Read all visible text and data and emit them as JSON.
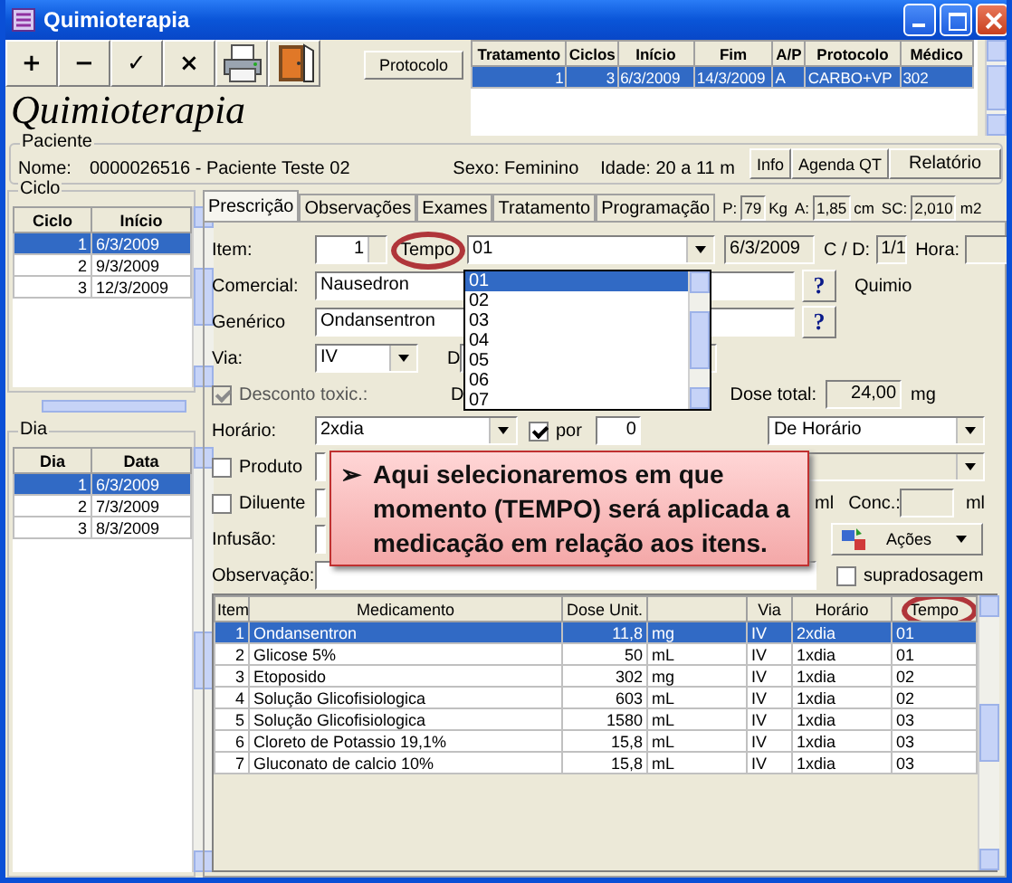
{
  "window": {
    "title": "Quimioterapia"
  },
  "toolbar": [
    {
      "kind": "glyph",
      "label": "+"
    },
    {
      "kind": "glyph",
      "label": "−"
    },
    {
      "kind": "glyph",
      "label": "✓"
    },
    {
      "kind": "glyph",
      "label": "×"
    },
    {
      "kind": "printer"
    },
    {
      "kind": "door"
    }
  ],
  "protocol_button": "Protocolo",
  "heading": "Quimioterapia",
  "treatments": {
    "columns": [
      "Tratamento",
      "Ciclos",
      "Início",
      "Fim",
      "A/P",
      "Protocolo",
      "Médico"
    ],
    "rows": [
      {
        "cells": [
          "1",
          "3",
          "6/3/2009",
          "14/3/2009",
          "A",
          "CARBO+VP",
          "302"
        ],
        "selected": true
      }
    ]
  },
  "patient": {
    "group": "Paciente",
    "name_label": "Nome:",
    "name": "0000026516 - Paciente Teste 02",
    "sex": "Sexo: Feminino",
    "age": "Idade: 20 a 11 m",
    "buttons": [
      "Info",
      "Agenda QT",
      "Relatório"
    ]
  },
  "cycles": {
    "group": "Ciclo",
    "columns": [
      "Ciclo",
      "Início"
    ],
    "rows": [
      {
        "cells": [
          "1",
          "6/3/2009"
        ],
        "selected": true
      },
      {
        "cells": [
          "2",
          "9/3/2009"
        ],
        "selected": false
      },
      {
        "cells": [
          "3",
          "12/3/2009"
        ],
        "selected": false
      }
    ]
  },
  "days": {
    "group": "Dia",
    "columns": [
      "Dia",
      "Data"
    ],
    "rows": [
      {
        "cells": [
          "1",
          "6/3/2009"
        ],
        "selected": true
      },
      {
        "cells": [
          "2",
          "7/3/2009"
        ],
        "selected": false
      },
      {
        "cells": [
          "3",
          "8/3/2009"
        ],
        "selected": false
      }
    ]
  },
  "tabs": [
    {
      "label": "Prescrição",
      "selected": true
    },
    {
      "label": "Observações",
      "selected": false
    },
    {
      "label": "Exames",
      "selected": false
    },
    {
      "label": "Tratamento",
      "selected": false
    },
    {
      "label": "Programação",
      "selected": false
    }
  ],
  "measures": [
    {
      "label": "P:",
      "value": "79",
      "unit": "Kg"
    },
    {
      "label": "A:",
      "value": "1,85",
      "unit": "cm"
    },
    {
      "label": "SC:",
      "value": "2,010",
      "unit": "m2"
    }
  ],
  "form": {
    "item": {
      "label": "Item:",
      "value": "1"
    },
    "tempo": {
      "label": "Tempo",
      "value": "01",
      "items": [
        {
          "label": "01",
          "selected": true
        },
        {
          "label": "02",
          "selected": false
        },
        {
          "label": "03",
          "selected": false
        },
        {
          "label": "04",
          "selected": false
        },
        {
          "label": "05",
          "selected": false
        },
        {
          "label": "06",
          "selected": false
        },
        {
          "label": "07",
          "selected": false
        }
      ]
    },
    "date": "6/3/2009",
    "cd": {
      "label": "C / D:",
      "value": "1/1"
    },
    "hora": {
      "label": "Hora:"
    },
    "comercial": {
      "label": "Comercial:",
      "value": "Nausedron",
      "help": "?",
      "note": "Quimio"
    },
    "generico": {
      "label": "Genérico",
      "value": "Ondansentron",
      "help": "?"
    },
    "via": {
      "label": "Via:",
      "value": "IV",
      "label_2": "D"
    },
    "desconto": {
      "label": "Desconto toxic.:",
      "checked": true,
      "disabled": true,
      "label_2": "D",
      "dose_total_label": "Dose total:",
      "dose_total": "24,00",
      "unit": "mg"
    },
    "horario": {
      "label": "Horário:",
      "value": "2xdia",
      "por": {
        "label": "por",
        "checked": true
      },
      "por_value": "0",
      "mode": "De Horário"
    },
    "produto": {
      "label": "Produto",
      "checked": false
    },
    "diluente": {
      "label": "Diluente",
      "checked": false,
      "unit": "ml",
      "conc_label": "Conc.:",
      "conc_unit": "ml"
    },
    "infusao": {
      "label": "Infusão:"
    },
    "acoes": "Ações",
    "observacao": {
      "label": "Observação:"
    },
    "supradosagem": {
      "label": "supradosagem",
      "checked": false
    }
  },
  "callout": {
    "bullet": "➢",
    "text": "Aqui selecionaremos em que momento (TEMPO) será aplicada a medicação em relação aos itens."
  },
  "items_table": {
    "columns": [
      "Item",
      "Medicamento",
      "Dose Unit.",
      "",
      "Via",
      "Horário",
      "Tempo"
    ],
    "rows": [
      {
        "cells": [
          "1",
          "Ondansentron",
          "11,8",
          "mg",
          "IV",
          "2xdia",
          "01"
        ],
        "selected": true
      },
      {
        "cells": [
          "2",
          "Glicose 5%",
          "50",
          "mL",
          "IV",
          "1xdia",
          "01"
        ],
        "selected": false
      },
      {
        "cells": [
          "3",
          "Etoposido",
          "302",
          "mg",
          "IV",
          "1xdia",
          "02"
        ],
        "selected": false
      },
      {
        "cells": [
          "4",
          "Solução Glicofisiologica",
          "603",
          "mL",
          "IV",
          "1xdia",
          "02"
        ],
        "selected": false
      },
      {
        "cells": [
          "5",
          "Solução Glicofisiologica",
          "1580",
          "mL",
          "IV",
          "1xdia",
          "03"
        ],
        "selected": false
      },
      {
        "cells": [
          "6",
          "Cloreto de Potassio 19,1%",
          "15,8",
          "mL",
          "IV",
          "1xdia",
          "03"
        ],
        "selected": false
      },
      {
        "cells": [
          "7",
          "Gluconato de calcio 10%",
          "15,8",
          "mL",
          "IV",
          "1xdia",
          "03"
        ],
        "selected": false
      }
    ]
  }
}
